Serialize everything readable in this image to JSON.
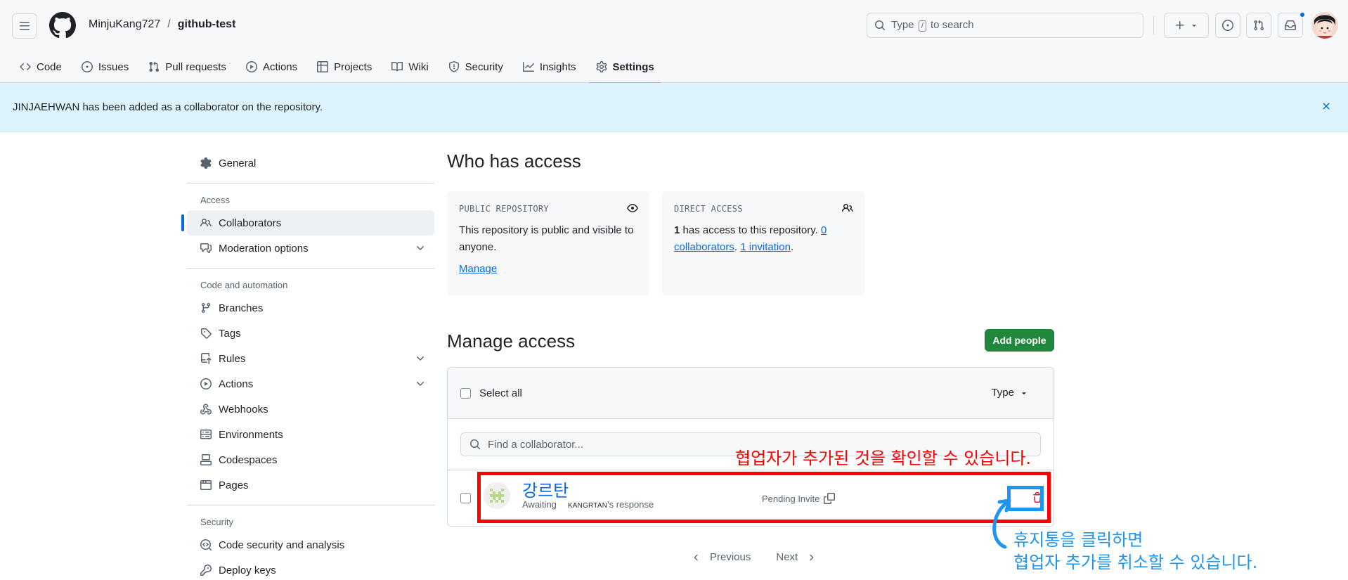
{
  "header": {
    "owner": "MinjuKang727",
    "separator": "/",
    "repo": "github-test",
    "search_prefix": "Type",
    "search_key": "/",
    "search_suffix": "to search"
  },
  "tabs": [
    {
      "label": "Code",
      "icon": "code-icon"
    },
    {
      "label": "Issues",
      "icon": "issue-icon"
    },
    {
      "label": "Pull requests",
      "icon": "pull-request-icon"
    },
    {
      "label": "Actions",
      "icon": "play-icon"
    },
    {
      "label": "Projects",
      "icon": "table-icon"
    },
    {
      "label": "Wiki",
      "icon": "book-icon"
    },
    {
      "label": "Security",
      "icon": "shield-icon"
    },
    {
      "label": "Insights",
      "icon": "graph-icon"
    },
    {
      "label": "Settings",
      "icon": "gear-icon",
      "active": true
    }
  ],
  "flash": {
    "message": "JINJAEHWAN has been added as a collaborator on the repository."
  },
  "sidebar": {
    "general": "General",
    "access_heading": "Access",
    "collaborators": "Collaborators",
    "moderation": "Moderation options",
    "code_heading": "Code and automation",
    "branches": "Branches",
    "tags": "Tags",
    "rules": "Rules",
    "actions": "Actions",
    "webhooks": "Webhooks",
    "environments": "Environments",
    "codespaces": "Codespaces",
    "pages": "Pages",
    "security_heading": "Security",
    "code_security": "Code security and analysis",
    "deploy_keys": "Deploy keys"
  },
  "who_has_access": {
    "title": "Who has access",
    "public_card": {
      "title": "PUBLIC REPOSITORY",
      "body": "This repository is public and visible to anyone.",
      "link": "Manage"
    },
    "direct_card": {
      "title": "DIRECT ACCESS",
      "count": "1",
      "text": "has access to this repository.",
      "collaborators_link": "0 collaborators",
      "dot": ".",
      "invitation_link": "1 invitation",
      "end": "."
    }
  },
  "manage_access": {
    "title": "Manage access",
    "add_button": "Add people",
    "select_all": "Select all",
    "type_filter": "Type",
    "find_placeholder": "Find a collaborator...",
    "collaborator": {
      "name": "강르탄",
      "status_prefix": "Awaiting",
      "username": "KANGRTAN",
      "status_suffix": "'s response",
      "pending": "Pending Invite"
    },
    "previous": "Previous",
    "next": "Next"
  },
  "annotations": {
    "red_note": "협업자가 추가된 것을 확인할 수 있습니다.",
    "blue_note_line1": "휴지통을 클릭하면",
    "blue_note_line2": "협업자 추가를 취소할 수 있습니다.",
    "red_color": "#ff0000",
    "blue_color": "#1e96f0"
  },
  "colors": {
    "accent": "#0969da",
    "success": "#1f883d",
    "danger": "#d1242f",
    "tab_underline": "#fd8c73",
    "flash_bg": "#ddf4ff"
  }
}
